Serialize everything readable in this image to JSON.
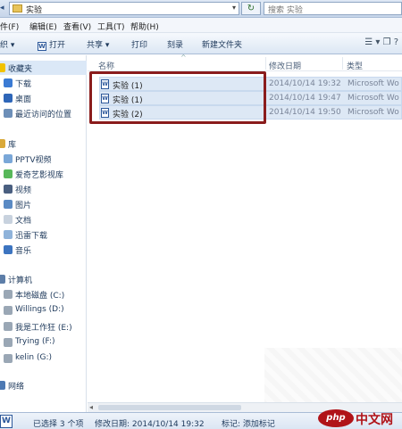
{
  "address": {
    "crumb": "实验",
    "search_placeholder": "搜索 实验"
  },
  "menu": [
    "件(F)",
    "编辑(E)",
    "查看(V)",
    "工具(T)",
    "帮助(H)"
  ],
  "toolbar": {
    "organize": "织 ▾",
    "open": "打开",
    "share": "共享 ▾",
    "print": "打印",
    "burn": "刻录",
    "new_folder": "新建文件夹",
    "view_icons": "☰ ▾  ❐  ?"
  },
  "sidebar": {
    "favorites": "收藏夹",
    "fav_items": [
      "下载",
      "桌面",
      "最近访问的位置"
    ],
    "library": "库",
    "lib_items": [
      "PPTV视频",
      "爱奇艺影视库",
      "视频",
      "图片",
      "文档",
      "迅雷下载",
      "音乐"
    ],
    "computer": "计算机",
    "drives": [
      "本地磁盘 (C:)",
      "Willings (D:)",
      "我是工作狂 (E:)",
      "Trying (F:)",
      "kelin (G:)"
    ],
    "network": "网络"
  },
  "columns": {
    "name": "名称",
    "date": "修改日期",
    "type": "类型"
  },
  "files": [
    {
      "name": "实验 (1)",
      "date": "2014/10/14 19:32",
      "type": "Microsoft Wo"
    },
    {
      "name": "实验 (1)",
      "date": "2014/10/14 19:47",
      "type": "Microsoft Wo"
    },
    {
      "name": "实验 (2)",
      "date": "2014/10/14 19:50",
      "type": "Microsoft Wo"
    }
  ],
  "status": {
    "selected": "已选择 3 个项",
    "modified": "修改日期: 2014/10/14 19:32",
    "tags": "标记: 添加标记"
  },
  "watermark": {
    "logo": "php",
    "text": "中文网"
  },
  "colors": {
    "highlight_box": "#8a1c1c",
    "selection": "#dde8f5"
  }
}
